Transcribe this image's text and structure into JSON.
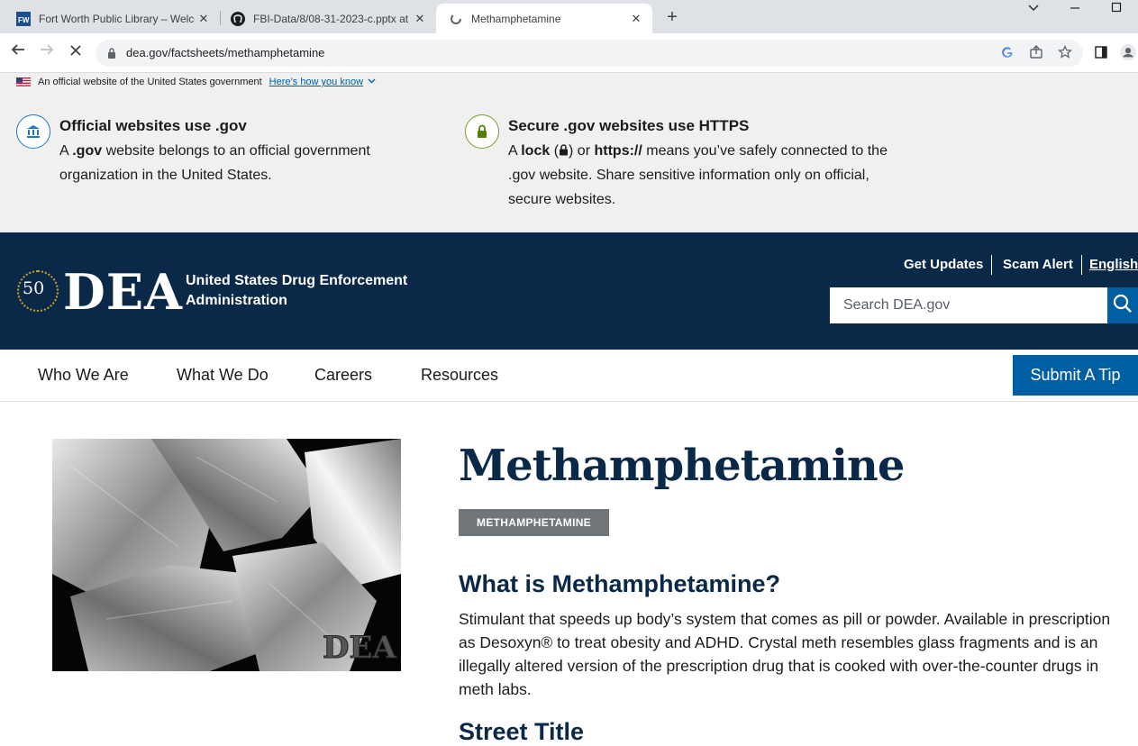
{
  "browser": {
    "tabs": [
      {
        "title": "Fort Worth Public Library – Welcome"
      },
      {
        "title": "FBI-Data/8/08-31-2023-c.pptx at"
      },
      {
        "title": "Methamphetamine"
      }
    ],
    "new_tab": "+",
    "url": "dea.gov/factsheets/methamphetamine"
  },
  "gov_banner": {
    "official_text": "An official website of the United States government",
    "how_link": "Here’s how you know",
    "gov_title": "Official websites use .gov",
    "gov_text_a": "A ",
    "gov_text_b": ".gov",
    "gov_text_c": " website belongs to an official government organization in the United States.",
    "https_title": "Secure .gov websites use HTTPS",
    "https_text_a": "A ",
    "https_text_lock": "lock",
    "https_text_b": " (",
    "https_text_c": ") or ",
    "https_text_https": "https://",
    "https_text_d": " means you’ve safely connected to the .gov website. Share sensitive information only on official, secure websites."
  },
  "header": {
    "logo_50": "50",
    "logo_word": "DEA",
    "agency_name": "United States Drug Enforcement Administration",
    "util_links": [
      "Get Updates",
      "Scam Alert",
      "English"
    ],
    "search_placeholder": "Search DEA.gov"
  },
  "nav": {
    "items": [
      "Who We Are",
      "What We Do",
      "Careers",
      "Resources"
    ],
    "submit_tip": "Submit A Tip"
  },
  "content": {
    "title": "Methamphetamine",
    "tag": "METHAMPHETAMINE",
    "section_heading": "What is Methamphetamine?",
    "description": "Stimulant that speeds up body’s system that comes as pill or powder. Available in prescription as Desoxyn® to treat obesity and ADHD. Crystal meth resembles glass fragments and is an illegally altered version of the prescription drug that is cooked with over-the-counter drugs in meth labs.",
    "next_heading": "Street Title",
    "image_watermark": "DEA"
  },
  "colors": {
    "navy": "#0a2847",
    "blue": "#005ea2",
    "tag_gray": "#71767a"
  }
}
